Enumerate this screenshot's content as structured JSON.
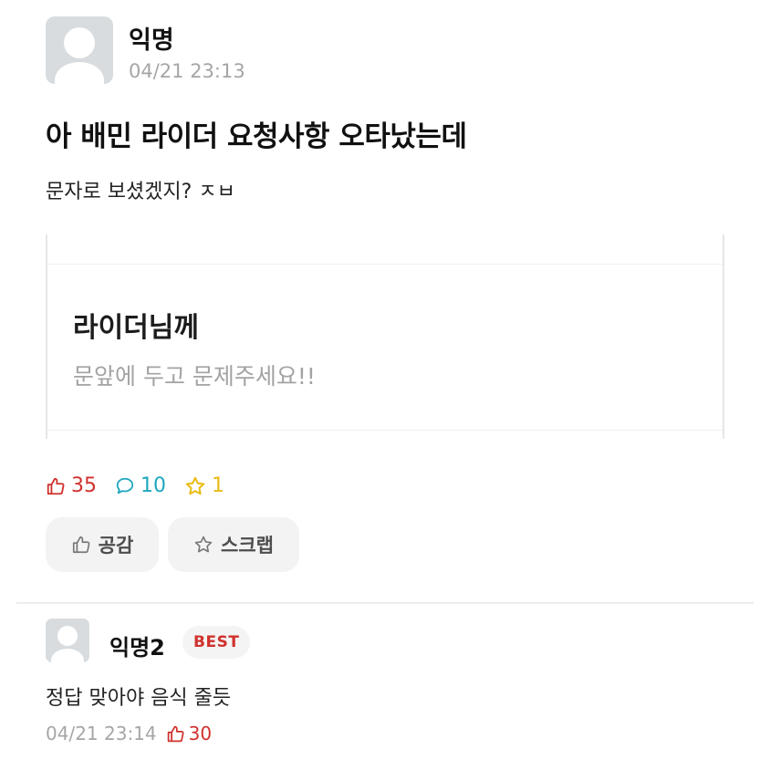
{
  "post": {
    "author": "익명",
    "time": "04/21 23:13",
    "title": "아 배민 라이더 요청사항 오타났는데",
    "body": "문자로 보셨겠지? ㅈㅂ",
    "image": {
      "heading": "라이더님께",
      "text": "문앞에 두고 문제주세요!!"
    },
    "stats": {
      "likes": "35",
      "comments": "10",
      "scraps": "1"
    },
    "actions": {
      "empathy": "공감",
      "scrap": "스크랩"
    }
  },
  "comment": {
    "author": "익명2",
    "badge": "BEST",
    "body": "정답 맞아야 음식 줄듯",
    "time": "04/21 23:14",
    "likes": "30"
  },
  "colors": {
    "like": "#d0312d",
    "comment": "#1fa7bd",
    "scrap": "#e9bb14",
    "avatar_bg": "#d8dcdf"
  },
  "icons": {
    "like": "thumbs-up-icon",
    "comment": "speech-bubble-icon",
    "scrap": "star-icon"
  }
}
